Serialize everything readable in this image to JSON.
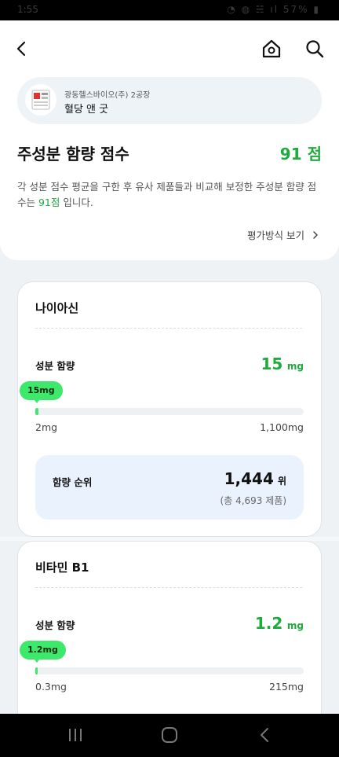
{
  "status_bar": {
    "time": "1:55",
    "right_icons": "◔ ◍ ☵ ıl 57% ▮"
  },
  "header": {
    "back_icon": "chevron-left",
    "home_icon": "house",
    "search_icon": "magnifier"
  },
  "product": {
    "maker": "광동헬스바이오(주) 2공장",
    "name": "혈당 앤 굿"
  },
  "score_section": {
    "title": "주성분 함량 점수",
    "score": "91 점",
    "desc_prefix": "각 성분 점수 평균을 구한 후 유사 제품들과 비교해 보정한 주성분 함량 점수는 ",
    "desc_highlight": "91점",
    "desc_suffix": " 입니다.",
    "method_link": "평가방식 보기"
  },
  "ingredients": [
    {
      "name": "나이아신",
      "content_label": "성분 함량",
      "value": "15",
      "unit": "mg",
      "bubble": "15mg",
      "min_label": "2mg",
      "max_label": "1,100mg",
      "fill_fraction": 0.012,
      "rank_label": "함량 순위",
      "rank": "1,444",
      "rank_unit": "위",
      "rank_total": "(총 4,693 제품)"
    },
    {
      "name": "비타민 B1",
      "content_label": "성분 함량",
      "value": "1.2",
      "unit": "mg",
      "bubble": "1.2mg",
      "min_label": "0.3mg",
      "max_label": "215mg",
      "fill_fraction": 0.004
    }
  ],
  "colors": {
    "accent": "#1eab3c",
    "bar_fill": "#3ee86a",
    "rank_bg": "#eaf3fd"
  }
}
